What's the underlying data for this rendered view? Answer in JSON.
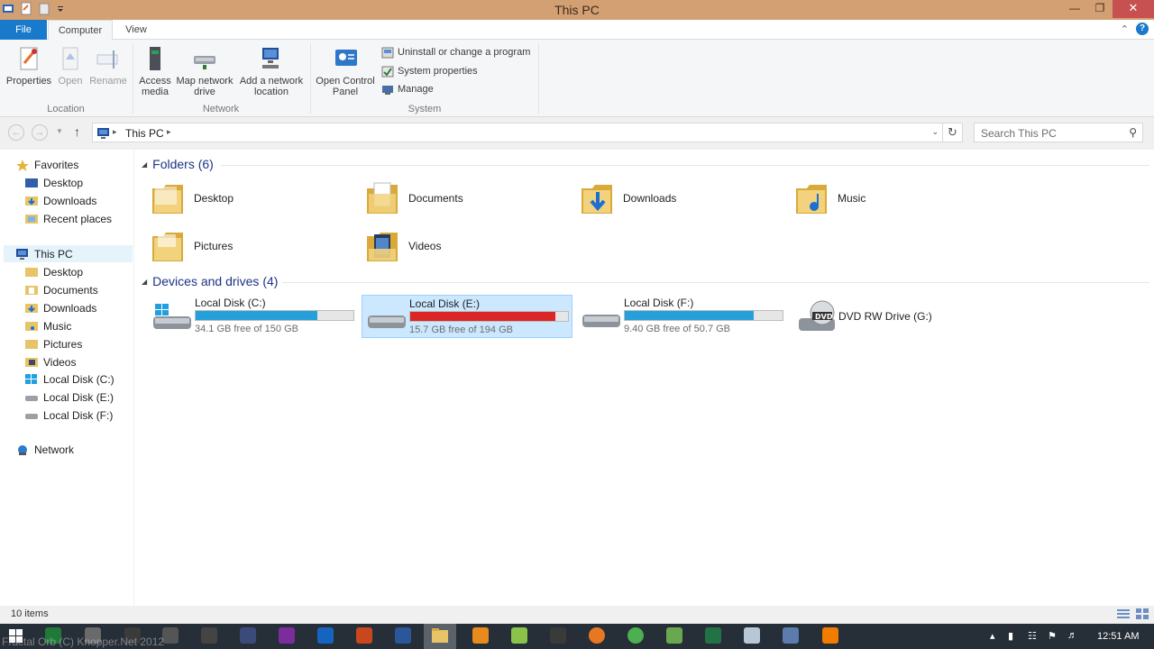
{
  "window": {
    "title": "This PC"
  },
  "ribbon_tabs": {
    "file": "File",
    "computer": "Computer",
    "view": "View"
  },
  "ribbon": {
    "location": {
      "label": "Location",
      "properties": "Properties",
      "open": "Open",
      "rename": "Rename"
    },
    "network": {
      "label": "Network",
      "access_media": "Access media",
      "map_network_drive": "Map network drive",
      "add_network_location": "Add a network location"
    },
    "system": {
      "label": "System",
      "open_control_panel": "Open Control Panel",
      "uninstall": "Uninstall or change a program",
      "system_properties": "System properties",
      "manage": "Manage"
    }
  },
  "address": {
    "crumb": "This PC",
    "search_placeholder": "Search This PC"
  },
  "nav": {
    "favorites": "Favorites",
    "desktop": "Desktop",
    "downloads": "Downloads",
    "recent": "Recent places",
    "this_pc": "This PC",
    "pc_desktop": "Desktop",
    "pc_documents": "Documents",
    "pc_downloads": "Downloads",
    "pc_music": "Music",
    "pc_pictures": "Pictures",
    "pc_videos": "Videos",
    "disk_c": "Local Disk (C:)",
    "disk_e": "Local Disk (E:)",
    "disk_f": "Local Disk (F:)",
    "network": "Network"
  },
  "folders_header": "Folders (6)",
  "folders": [
    "Desktop",
    "Documents",
    "Downloads",
    "Music",
    "Pictures",
    "Videos"
  ],
  "devices_header": "Devices and drives (4)",
  "drives": [
    {
      "name": "Local Disk (C:)",
      "free": "34.1 GB free of 150 GB",
      "used_fraction": 0.773,
      "color": "#26a0da"
    },
    {
      "name": "Local Disk (E:)",
      "free": "15.7 GB free of 194 GB",
      "used_fraction": 0.919,
      "color": "#da2626"
    },
    {
      "name": "Local Disk (F:)",
      "free": "9.40 GB free of 50.7 GB",
      "used_fraction": 0.815,
      "color": "#26a0da"
    },
    {
      "name": "DVD RW Drive (G:)"
    }
  ],
  "status": {
    "items": "10 items"
  },
  "taskbar": {
    "watermark": "Fractal Orb (C) Knopper.Net 2012",
    "clock": "12:51 AM"
  },
  "colors": {
    "title_bar": "#d3a073",
    "file_tab": "#1979ca",
    "taskbar": "#262e37"
  }
}
